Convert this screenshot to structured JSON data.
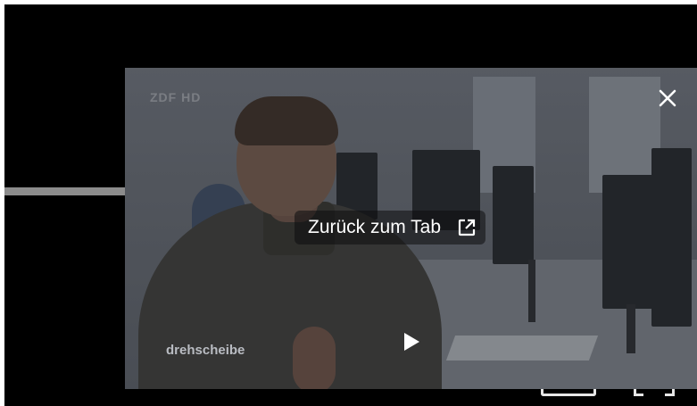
{
  "player": {
    "background_color": "#000000",
    "progress_track_color": "#8c8c8c"
  },
  "pip_window": {
    "channel_logo": "ZDF HD",
    "show_logo": "drehscheibe",
    "back_to_tab_label": "Zurück zum Tab",
    "icons": {
      "close": "close-icon",
      "back_to_tab": "open-in-new-icon",
      "play": "play-icon"
    }
  }
}
